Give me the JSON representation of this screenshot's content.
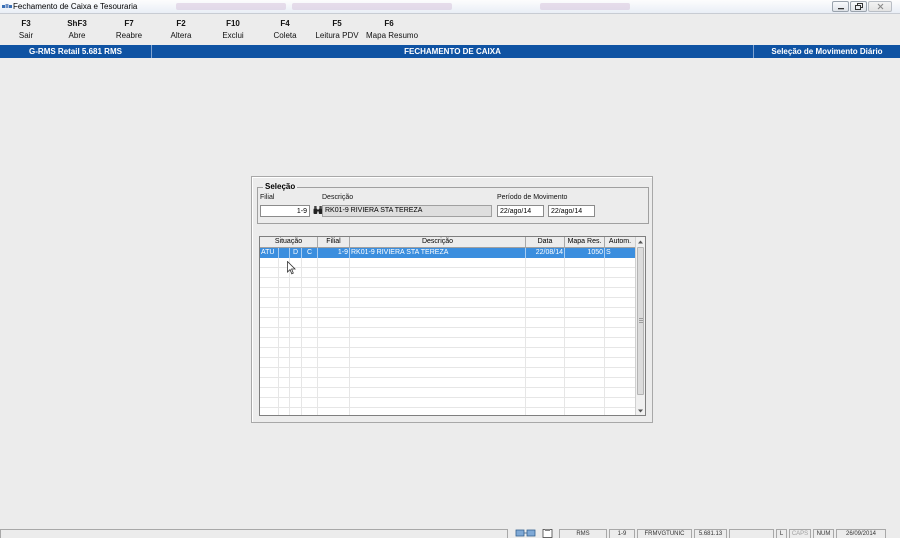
{
  "window": {
    "title": "Fechamento de Caixa e Tesouraria",
    "icons": [
      "app-icon",
      "minimize-icon",
      "restore-icon",
      "close-icon"
    ]
  },
  "toolbar": {
    "items": [
      {
        "key": "F3",
        "label": "Sair"
      },
      {
        "key": "ShF3",
        "label": "Abre"
      },
      {
        "key": "F7",
        "label": "Reabre"
      },
      {
        "key": "F2",
        "label": "Altera"
      },
      {
        "key": "F10",
        "label": "Exclui"
      },
      {
        "key": "F4",
        "label": "Coleta"
      },
      {
        "key": "F5",
        "label": "Leitura PDV"
      },
      {
        "key": "F6",
        "label": "Mapa Resumo"
      }
    ]
  },
  "header": {
    "system": "G-RMS Retail 5.681 RMS",
    "screen": "FECHAMENTO DE CAIXA",
    "context": "Seleção de Movimento Diário",
    "color": "#0f53a3"
  },
  "selection": {
    "title": "Seleção",
    "filial_label": "Filial",
    "filial_value": "1-9",
    "descricao_label": "Descrição",
    "descricao_value": "RK01-9 RIVIERA STA TEREZA",
    "periodo_label": "Período de Movimento",
    "periodo_inicio": "22/ago/14",
    "periodo_fim": "22/ago/14",
    "search_icon": "binoculars-icon"
  },
  "grid": {
    "columns": [
      "Situação",
      "Filial",
      "Descrição",
      "Data",
      "Mapa Res.",
      "Autom."
    ],
    "rows": [
      {
        "situacao": "ATU",
        "flag1": "",
        "flag2": "D",
        "flag3": "C",
        "filial": "1-9",
        "descricao": "RK01-9 RIVIERA STA TEREZA",
        "data": "22/08/14",
        "mapa": "1050",
        "autom": "S"
      }
    ],
    "selected_color": "#3b8ede"
  },
  "statusbar": {
    "user": "RMS",
    "filial": "1-9",
    "form": "FRMVGTUNIC",
    "version": "5.681.13",
    "lock": "L",
    "caps": "CAPS",
    "num": "NUM",
    "date": "26/09/2014",
    "icons": [
      "network-icon",
      "clipboard-icon"
    ]
  }
}
